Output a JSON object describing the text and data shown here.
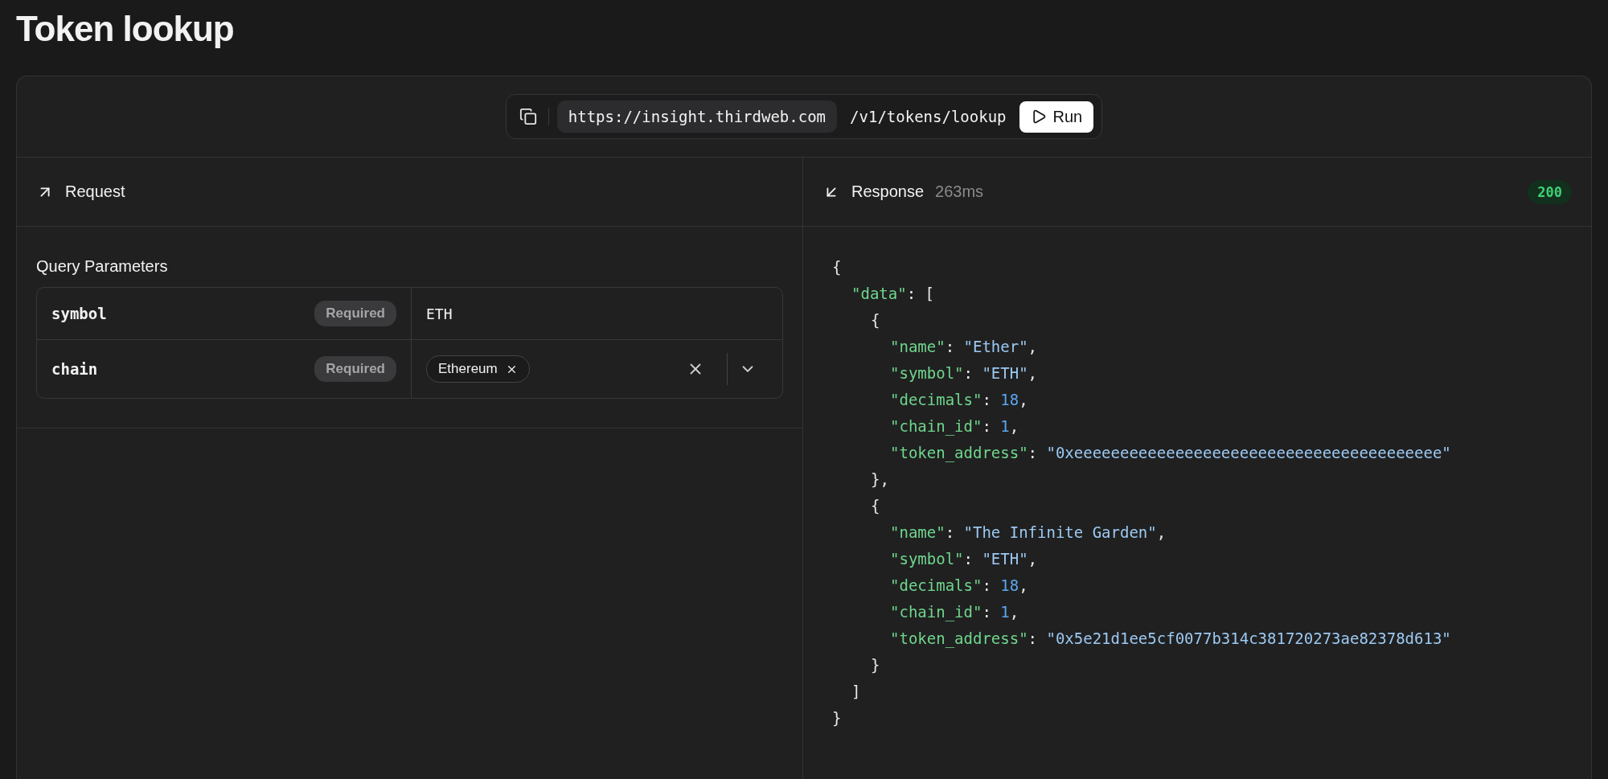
{
  "page": {
    "title": "Token lookup"
  },
  "url_bar": {
    "base_url": "https://insight.thirdweb.com",
    "path": "/v1/tokens/lookup",
    "run_label": "Run"
  },
  "request": {
    "title": "Request",
    "section_title": "Query Parameters",
    "params": [
      {
        "name": "symbol",
        "badge": "Required",
        "kind": "text",
        "value": "ETH"
      },
      {
        "name": "chain",
        "badge": "Required",
        "kind": "multiselect",
        "chips": [
          "Ethereum"
        ]
      }
    ]
  },
  "response": {
    "title": "Response",
    "duration": "263ms",
    "status": "200",
    "body": {
      "kind": "container",
      "open": "{",
      "close": "}",
      "children": [
        {
          "kind": "container",
          "key": "\"data\"",
          "sep": ": ",
          "open": "[",
          "close": "]",
          "children": [
            {
              "kind": "container",
              "open": "{",
              "close": "}",
              "end": ",",
              "children": [
                {
                  "kind": "string",
                  "key": "\"name\"",
                  "sep": ": ",
                  "value": "\"Ether\"",
                  "end": ","
                },
                {
                  "kind": "string",
                  "key": "\"symbol\"",
                  "sep": ": ",
                  "value": "\"ETH\"",
                  "end": ","
                },
                {
                  "kind": "number",
                  "key": "\"decimals\"",
                  "sep": ": ",
                  "value": "18",
                  "end": ","
                },
                {
                  "kind": "number",
                  "key": "\"chain_id\"",
                  "sep": ": ",
                  "value": "1",
                  "end": ","
                },
                {
                  "kind": "string",
                  "key": "\"token_address\"",
                  "sep": ": ",
                  "value": "\"0xeeeeeeeeeeeeeeeeeeeeeeeeeeeeeeeeeeeeeeee\""
                }
              ]
            },
            {
              "kind": "container",
              "open": "{",
              "close": "}",
              "children": [
                {
                  "kind": "string",
                  "key": "\"name\"",
                  "sep": ": ",
                  "value": "\"The Infinite Garden\"",
                  "end": ","
                },
                {
                  "kind": "string",
                  "key": "\"symbol\"",
                  "sep": ": ",
                  "value": "\"ETH\"",
                  "end": ","
                },
                {
                  "kind": "number",
                  "key": "\"decimals\"",
                  "sep": ": ",
                  "value": "18",
                  "end": ","
                },
                {
                  "kind": "number",
                  "key": "\"chain_id\"",
                  "sep": ": ",
                  "value": "1",
                  "end": ","
                },
                {
                  "kind": "string",
                  "key": "\"token_address\"",
                  "sep": ": ",
                  "value": "\"0x5e21d1ee5cf0077b314c381720273ae82378d613\""
                }
              ]
            }
          ]
        }
      ]
    }
  }
}
